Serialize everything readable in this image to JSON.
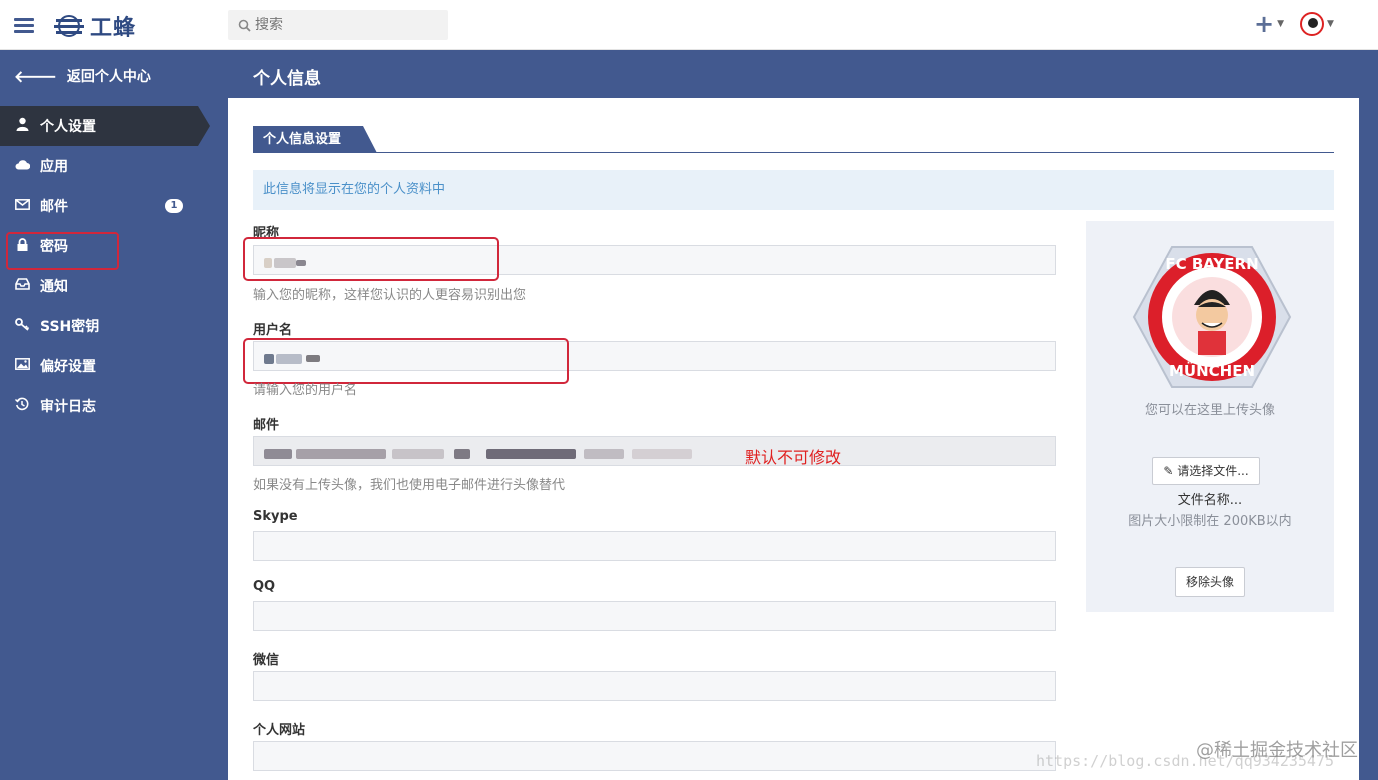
{
  "header": {
    "logo_text": "工蜂",
    "search_placeholder": "搜索",
    "plus_icon": "plus-icon",
    "colors": {
      "primary": "#42598f",
      "sidebar_active": "#2e3440",
      "highlight_red": "#d1273b"
    }
  },
  "sidebar": {
    "back_label": "返回个人中心",
    "items": [
      {
        "label": "个人设置",
        "icon": "user-icon",
        "active": true
      },
      {
        "label": "应用",
        "icon": "cloud-icon",
        "active": false
      },
      {
        "label": "邮件",
        "icon": "envelope-icon",
        "active": false,
        "badge": "1"
      },
      {
        "label": "密码",
        "icon": "lock-icon",
        "active": false
      },
      {
        "label": "通知",
        "icon": "inbox-icon",
        "active": false
      },
      {
        "label": "SSH密钥",
        "icon": "key-icon",
        "active": false
      },
      {
        "label": "偏好设置",
        "icon": "image-icon",
        "active": false
      },
      {
        "label": "审计日志",
        "icon": "history-icon",
        "active": false
      }
    ]
  },
  "main": {
    "title": "个人信息",
    "tab": "个人信息设置",
    "info": "此信息将显示在您的个人资料中",
    "fields": {
      "nickname": {
        "label": "昵称",
        "help": "输入您的昵称，这样您认识的人更容易识别出您"
      },
      "username": {
        "label": "用户名",
        "help": "请输入您的用户名"
      },
      "email": {
        "label": "邮件",
        "help": "如果没有上传头像，我们也使用电子邮件进行头像替代",
        "note": "默认不可修改"
      },
      "skype": {
        "label": "Skype"
      },
      "qq": {
        "label": "QQ"
      },
      "wechat": {
        "label": "微信"
      },
      "website": {
        "label": "个人网站"
      }
    },
    "avatar": {
      "hint": "您可以在这里上传头像",
      "choose_button": "请选择文件...",
      "file_name": "文件名称...",
      "size_limit": "图片大小限制在 200KB以内",
      "remove_button": "移除头像",
      "logo_text_top": "FC BAYERN",
      "logo_text_bottom": "MÜNCHEN"
    }
  },
  "watermark": {
    "line1": "@稀土掘金技术社区",
    "line2": "https://blog.csdn.net/qq934235475"
  }
}
